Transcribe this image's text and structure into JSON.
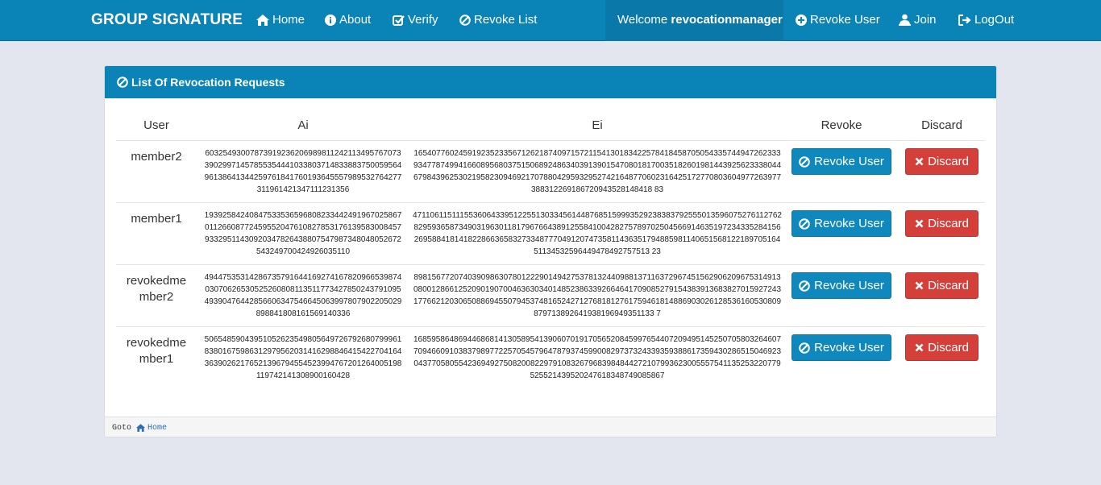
{
  "nav": {
    "brand": "GROUP SIGNATURE",
    "home": "Home",
    "about": "About",
    "verify": "Verify",
    "revoke_list": "Revoke List",
    "welcome_prefix": "Welcome ",
    "username": "revocationmanager",
    "revoke_user": "Revoke User",
    "join": "Join",
    "logout": "LogOut"
  },
  "panel": {
    "title": "List Of Revocation Requests",
    "columns": [
      "User",
      "Ai",
      "Ei",
      "Revoke",
      "Discard"
    ],
    "revoke_label": "Revoke User",
    "discard_label": "Discard",
    "rows": [
      {
        "user": "member2",
        "ai": "603254930078739192362069898112421134957670733902997145785535444103380371483388375005956496138641344259761841760193645557989532764277311961421347111231356",
        "ei": "165407760245919235233567126218740971572115413018342257841845870505433574494726233393477874994166089568037515068924863403913901547080181700351826019814439256233380446798439625302195823094692170788042959329527421648770602316425172770803604977263977388312269186720943528148418 83"
      },
      {
        "user": "revokedme mber2",
        "ai": "494475353142867357916441692741678209665398740307062653052526080811351177342785024379109549390476442856606347546645063997807902205029898841808161569140336",
        "ei": "898156772074039098630780122290149427537813244098813711637296745156290620967531491308001286612520901907004636303401485238633926646417090852791543839136838270159272431776621203065088694550794537481652427127681812761759461814886903026128536160530809879713892641938196949351133 7"
      },
      {
        "user": "revokedme mber1",
        "ai": "506548590439510526235498056497267926807999618380167598631297956203141629884641542270416436390262176521396794554523994767201264005198119742141308900160428",
        "ei": "168595864869446868141305895413906070191705652084599765440720949514525070580326460770946609103837989772257054579647879374599008297373243393593886173594302865150469230437705805542369492750820082297910832679683984844272107993623005557541135253220779525521439520247618348749085867"
      },
      {
        "user": "member1",
        "ai": "193925842408475335365968082334424919670258670112660877245955204761082785317613958300845793329511430920347826438807547987348048052672543249700424926035110",
        "ei": "471106115111553606433951225513033456144876851599935292383837925550135960752761127628295936587349031963011817967664389125584100428275789702504566914635197234335284156269588418141822866365832733487770491207473581143635179488598114065156812218970516451134532596449478492757513 23"
      }
    ]
  },
  "footer": {
    "goto": "Goto",
    "home": "Home"
  }
}
